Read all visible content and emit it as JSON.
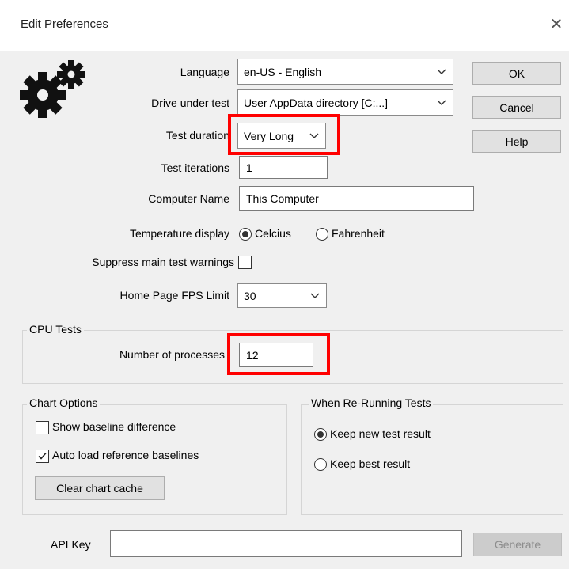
{
  "dialog": {
    "title": "Edit Preferences",
    "close_glyph": "✕",
    "icon": "gears-icon"
  },
  "form": {
    "language": {
      "label": "Language",
      "value": "en-US - English"
    },
    "drive": {
      "label": "Drive under test",
      "value": "User AppData directory [C:...]"
    },
    "duration": {
      "label": "Test duration",
      "value": "Very Long"
    },
    "iterations": {
      "label": "Test iterations",
      "value": "1"
    },
    "computer_name": {
      "label": "Computer Name",
      "value": "This Computer"
    },
    "temperature": {
      "label": "Temperature display",
      "options": [
        "Celcius",
        "Fahrenheit"
      ],
      "selected": "Celcius"
    },
    "suppress": {
      "label": "Suppress main test warnings",
      "checked": false
    },
    "fps": {
      "label": "Home Page FPS Limit",
      "value": "30"
    }
  },
  "buttons": {
    "ok": "OK",
    "cancel": "Cancel",
    "help": "Help",
    "clear_cache": "Clear chart cache",
    "generate": "Generate"
  },
  "cpu_tests": {
    "title": "CPU Tests",
    "processes_label": "Number of processes",
    "processes_value": "12"
  },
  "chart_options": {
    "title": "Chart Options",
    "show_baseline": {
      "label": "Show baseline difference",
      "checked": false
    },
    "auto_load": {
      "label": "Auto load reference baselines",
      "checked": true
    }
  },
  "rerun": {
    "title": "When Re-Running Tests",
    "options": [
      "Keep new test result",
      "Keep best result"
    ],
    "selected": "Keep new test result"
  },
  "api": {
    "label": "API Key",
    "value": ""
  },
  "colors": {
    "highlight": "#ff0000",
    "window_bg": "#f0f0f0",
    "button_bg": "#e1e1e1"
  }
}
